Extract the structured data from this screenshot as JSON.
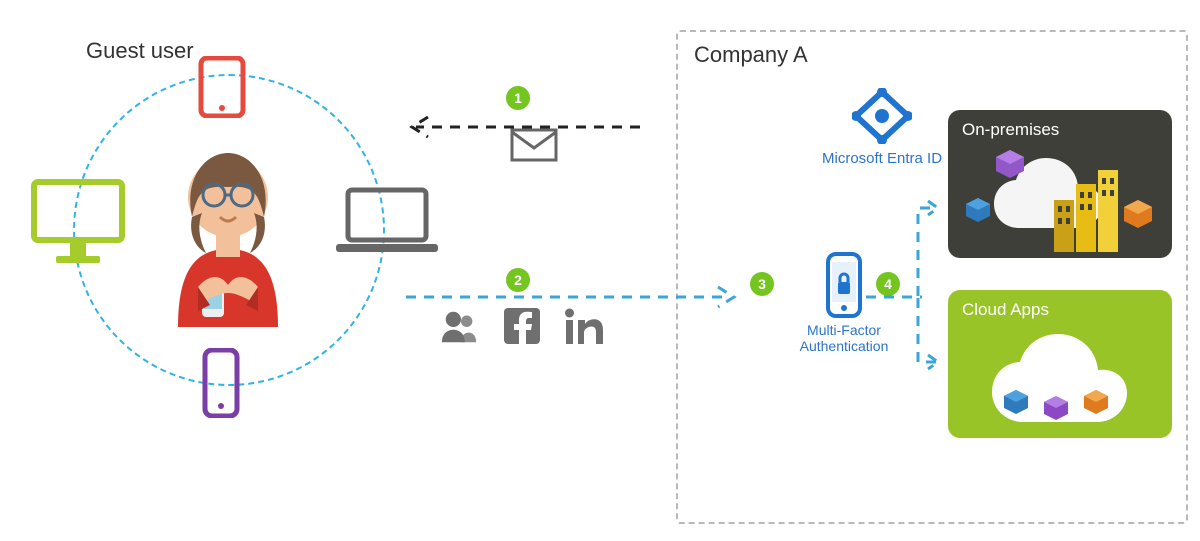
{
  "guest_user": {
    "title": "Guest user"
  },
  "company": {
    "title": "Company A"
  },
  "steps": {
    "s1": "1",
    "s2": "2",
    "s3": "3",
    "s4": "4"
  },
  "services": {
    "entra_label": "Microsoft Entra ID",
    "mfa_label_line1": "Multi-Factor",
    "mfa_label_line2": "Authentication"
  },
  "tiles": {
    "onprem": "On-premises",
    "cloud": "Cloud Apps"
  },
  "identity_providers": {
    "azure_ad_icon": "azure-ad",
    "facebook_icon": "facebook",
    "linkedin_icon": "linkedin"
  },
  "colors": {
    "accent_blue": "#2a74cf",
    "step_green": "#74c51f",
    "circle_blue": "#31b3e3",
    "tile_dark": "#3f3f3a",
    "tile_green": "#99c428"
  }
}
